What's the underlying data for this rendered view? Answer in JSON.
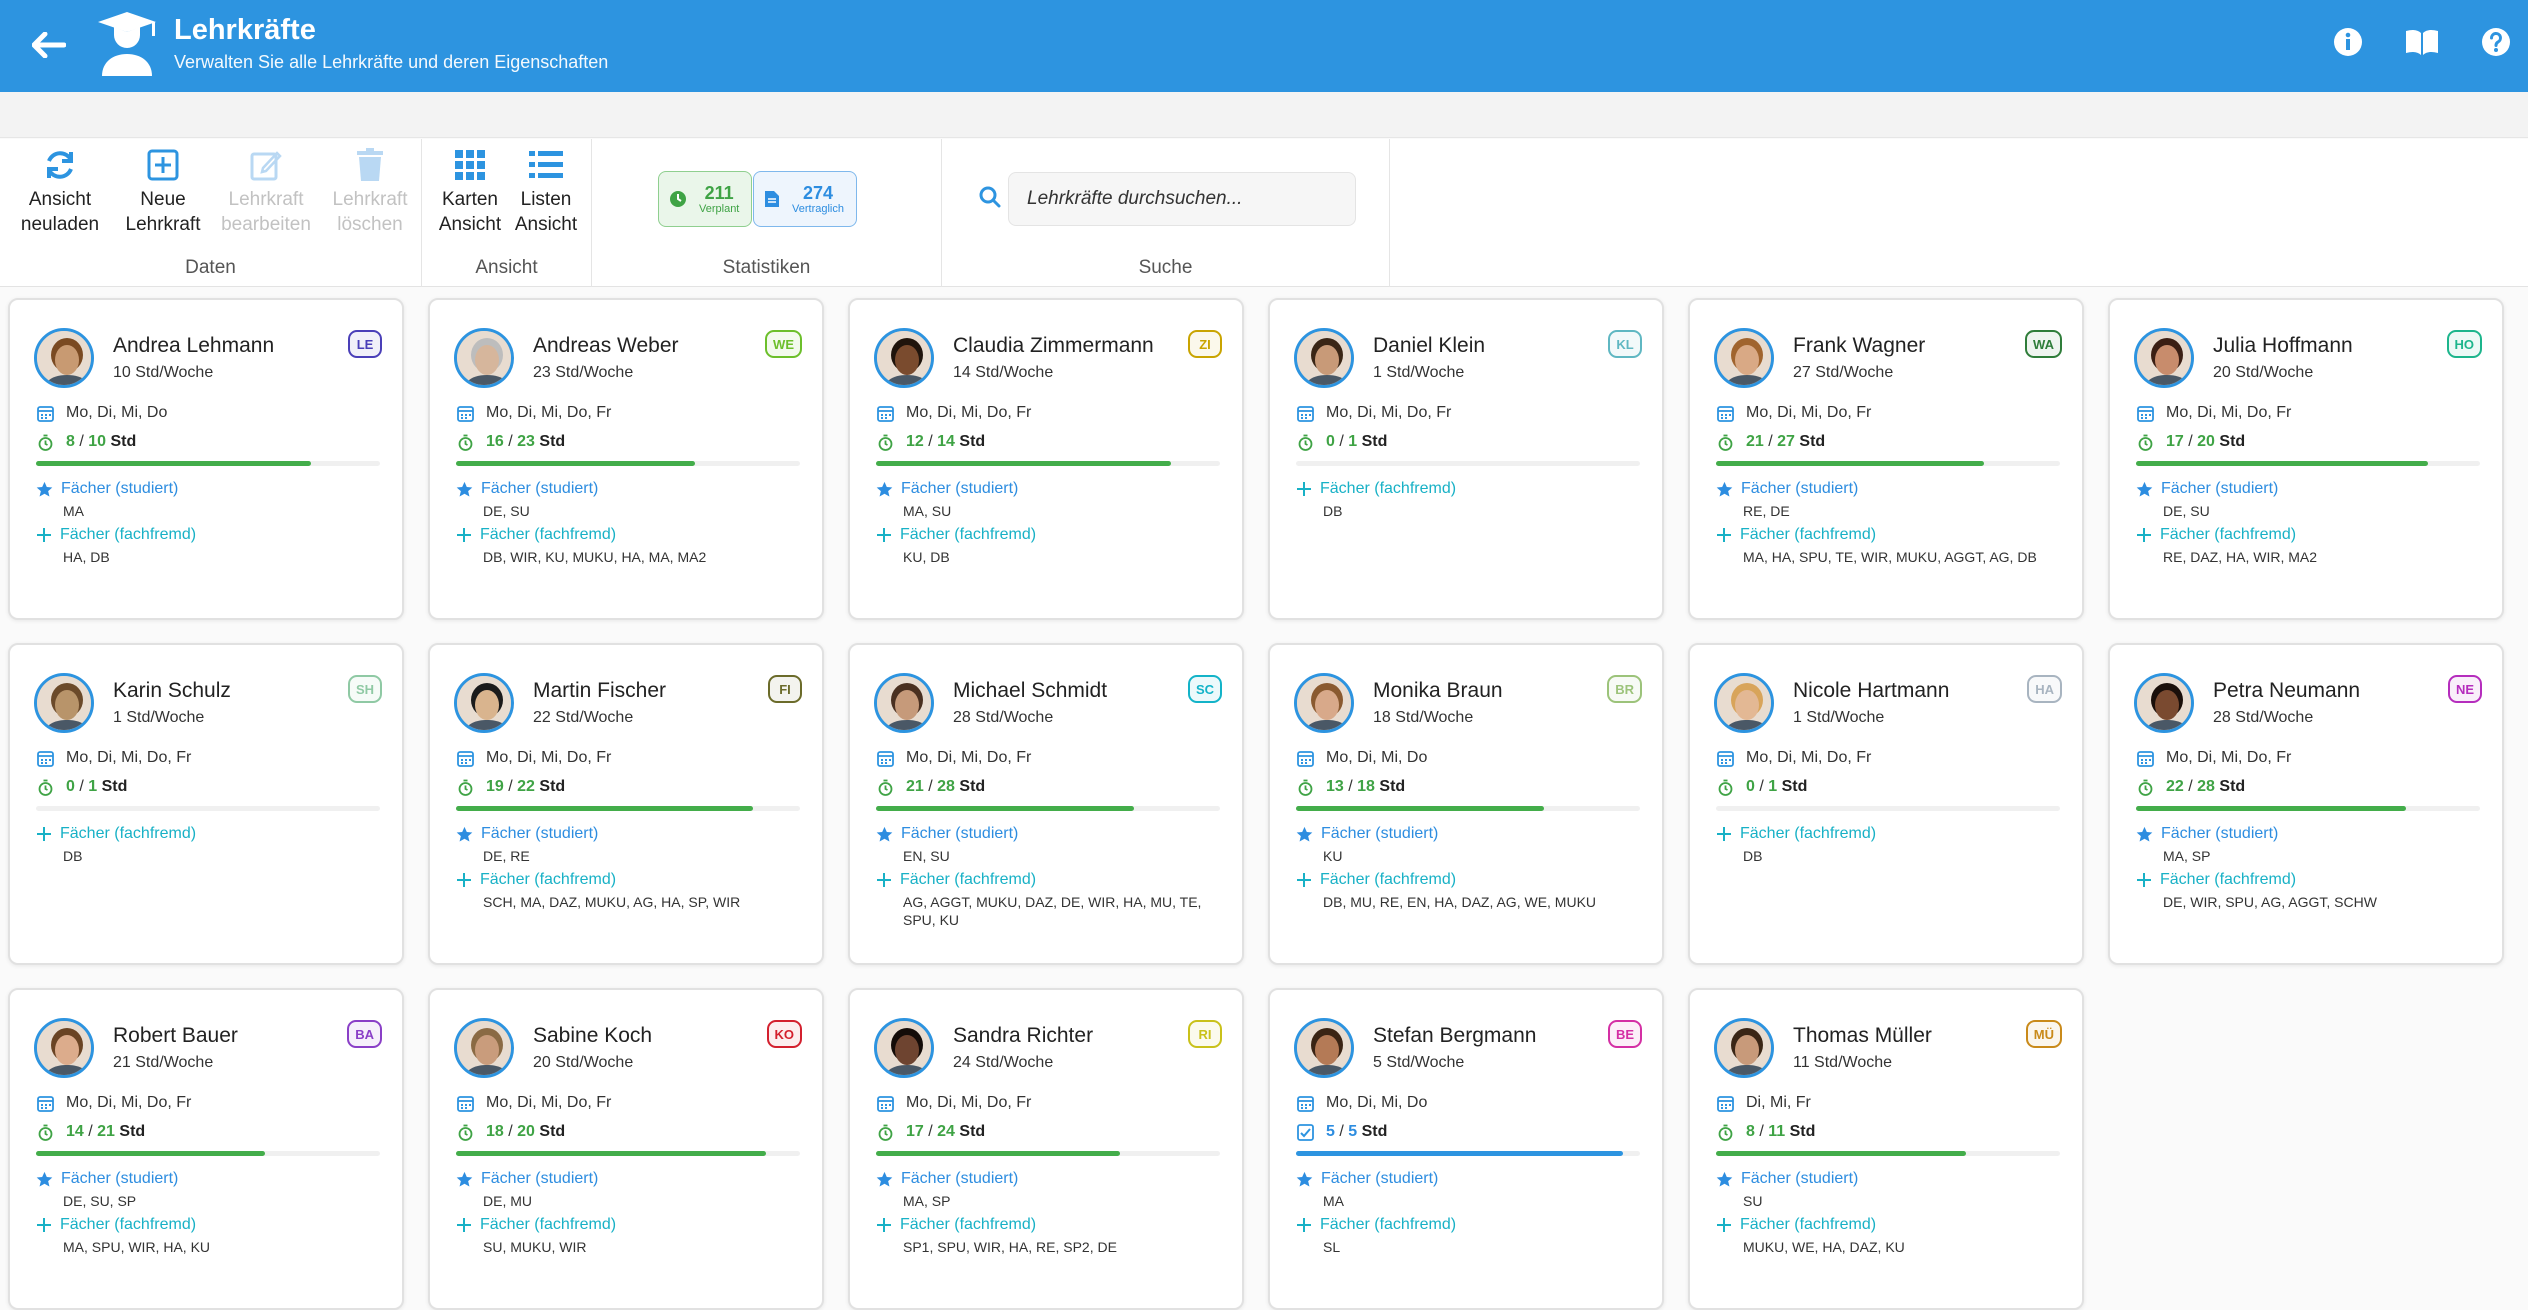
{
  "header": {
    "title": "Lehrkräfte",
    "subtitle": "Verwalten Sie alle Lehrkräfte und deren Eigenschaften"
  },
  "ribbon": {
    "daten": {
      "title": "Daten",
      "reload": "Ansicht neuladen",
      "new": "Neue Lehrkraft",
      "edit": "Lehrkraft bearbeiten",
      "delete": "Lehrkraft löschen"
    },
    "ansicht": {
      "title": "Ansicht",
      "cards": "Karten Ansicht",
      "list": "Listen Ansicht"
    },
    "statistiken": {
      "title": "Statistiken",
      "planned_value": "211",
      "planned_label": "Verplant",
      "contract_value": "274",
      "contract_label": "Vertraglich"
    },
    "suche": {
      "title": "Suche",
      "placeholder": "Lehrkräfte durchsuchen..."
    }
  },
  "labels": {
    "studied": "Fächer (studiert)",
    "foreign": "Fächer (fachfremd)",
    "std": "Std"
  },
  "teachers": [
    {
      "name": "Andrea Lehmann",
      "hours": "10 Std/Woche",
      "kuerzel": "LE",
      "badge_color": "#4a3fb8",
      "days": "Mo, Di, Mi, Do",
      "planned": "8",
      "total": "10",
      "progress": 0.8,
      "studied": "MA",
      "foreign": "HA, DB",
      "bar_color": "#43ad4a",
      "avatar": "#c89a72",
      "hair": "#7a4a22"
    },
    {
      "name": "Andreas Weber",
      "hours": "23 Std/Woche",
      "kuerzel": "WE",
      "badge_color": "#6cbf2b",
      "days": "Mo, Di, Mi, Do, Fr",
      "planned": "16",
      "total": "23",
      "progress": 0.696,
      "studied": "DE, SU",
      "foreign": "DB, WIR, KU, MUKU, HA, MA, MA2",
      "bar_color": "#43ad4a",
      "avatar": "#d6b69c",
      "hair": "#bdbdbd"
    },
    {
      "name": "Claudia Zimmermann",
      "hours": "14 Std/Woche",
      "kuerzel": "ZI",
      "badge_color": "#c9a400",
      "days": "Mo, Di, Mi, Do, Fr",
      "planned": "12",
      "total": "14",
      "progress": 0.857,
      "studied": "MA, SU",
      "foreign": "KU, DB",
      "bar_color": "#43ad4a",
      "avatar": "#7a4b2e",
      "hair": "#1f140c"
    },
    {
      "name": "Daniel Klein",
      "hours": "1 Std/Woche",
      "kuerzel": "KL",
      "badge_color": "#5fb7c2",
      "days": "Mo, Di, Mi, Do, Fr",
      "planned": "0",
      "total": "1",
      "progress": 0,
      "studied": "",
      "foreign": "DB",
      "bar_color": "#43ad4a",
      "avatar": "#c89a78",
      "hair": "#3a2616"
    },
    {
      "name": "Frank Wagner",
      "hours": "27 Std/Woche",
      "kuerzel": "WA",
      "badge_color": "#2f7d3a",
      "days": "Mo, Di, Mi, Do, Fr",
      "planned": "21",
      "total": "27",
      "progress": 0.778,
      "studied": "RE, DE",
      "foreign": "MA, HA, SPU, TE, WIR, MUKU, AGGT, AG, DB",
      "bar_color": "#43ad4a",
      "avatar": "#d9a985",
      "hair": "#a0642e"
    },
    {
      "name": "Julia Hoffmann",
      "hours": "20 Std/Woche",
      "kuerzel": "HO",
      "badge_color": "#1db58c",
      "days": "Mo, Di, Mi, Do, Fr",
      "planned": "17",
      "total": "20",
      "progress": 0.85,
      "studied": "DE, SU",
      "foreign": "RE, DAZ, HA, WIR, MA2",
      "bar_color": "#43ad4a",
      "avatar": "#c88c6c",
      "hair": "#3b1f14"
    },
    {
      "name": "Karin Schulz",
      "hours": "1 Std/Woche",
      "kuerzel": "SH",
      "badge_color": "#8fc9a4",
      "days": "Mo, Di, Mi, Do, Fr",
      "planned": "0",
      "total": "1",
      "progress": 0,
      "studied": "",
      "foreign": "DB",
      "bar_color": "#43ad4a",
      "avatar": "#b8946a",
      "hair": "#6b4a2a"
    },
    {
      "name": "Martin Fischer",
      "hours": "22 Std/Woche",
      "kuerzel": "FI",
      "badge_color": "#6b6b2a",
      "days": "Mo, Di, Mi, Do, Fr",
      "planned": "19",
      "total": "22",
      "progress": 0.864,
      "studied": "DE, RE",
      "foreign": "SCH, MA, DAZ, MUKU, AG, HA, SP, WIR",
      "bar_color": "#43ad4a",
      "avatar": "#d9b48e",
      "hair": "#1b1b1b"
    },
    {
      "name": "Michael Schmidt",
      "hours": "28 Std/Woche",
      "kuerzel": "SC",
      "badge_color": "#13b3c8",
      "days": "Mo, Di, Mi, Do, Fr",
      "planned": "21",
      "total": "28",
      "progress": 0.75,
      "studied": "EN, SU",
      "foreign": "AG, AGGT, MUKU, DAZ, DE, WIR, HA, MU, TE, SPU, KU",
      "bar_color": "#43ad4a",
      "avatar": "#c69a7a",
      "hair": "#4a3020"
    },
    {
      "name": "Monika Braun",
      "hours": "18 Std/Woche",
      "kuerzel": "BR",
      "badge_color": "#9cc37a",
      "days": "Mo, Di, Mi, Do",
      "planned": "13",
      "total": "18",
      "progress": 0.722,
      "studied": "KU",
      "foreign": "DB, MU, RE, EN, HA, DAZ, AG, WE, MUKU",
      "bar_color": "#43ad4a",
      "avatar": "#d8a98a",
      "hair": "#8a5a30"
    },
    {
      "name": "Nicole Hartmann",
      "hours": "1 Std/Woche",
      "kuerzel": "HA",
      "badge_color": "#a8b4c0",
      "days": "Mo, Di, Mi, Do, Fr",
      "planned": "0",
      "total": "1",
      "progress": 0,
      "studied": "",
      "foreign": "DB",
      "bar_color": "#43ad4a",
      "avatar": "#e3b894",
      "hair": "#d8a45a"
    },
    {
      "name": "Petra Neumann",
      "hours": "28 Std/Woche",
      "kuerzel": "NE",
      "badge_color": "#b52dbd",
      "days": "Mo, Di, Mi, Do, Fr",
      "planned": "22",
      "total": "28",
      "progress": 0.786,
      "studied": "MA, SP",
      "foreign": "DE, WIR, SPU, AG, AGGT, SCHW",
      "bar_color": "#43ad4a",
      "avatar": "#7a4a30",
      "hair": "#1a0f0a"
    },
    {
      "name": "Robert Bauer",
      "hours": "21 Std/Woche",
      "kuerzel": "BA",
      "badge_color": "#8a3fc7",
      "days": "Mo, Di, Mi, Do, Fr",
      "planned": "14",
      "total": "21",
      "progress": 0.667,
      "studied": "DE, SU, SP",
      "foreign": "MA, SPU, WIR, HA, KU",
      "bar_color": "#43ad4a",
      "avatar": "#dcac8c",
      "hair": "#6a4424"
    },
    {
      "name": "Sabine Koch",
      "hours": "20 Std/Woche",
      "kuerzel": "KO",
      "badge_color": "#d3202e",
      "days": "Mo, Di, Mi, Do, Fr",
      "planned": "18",
      "total": "20",
      "progress": 0.9,
      "studied": "DE, MU",
      "foreign": "SU, MUKU, WIR",
      "bar_color": "#43ad4a",
      "avatar": "#c99c7c",
      "hair": "#8a6a44"
    },
    {
      "name": "Sandra Richter",
      "hours": "24 Std/Woche",
      "kuerzel": "RI",
      "badge_color": "#c9c11a",
      "days": "Mo, Di, Mi, Do, Fr",
      "planned": "17",
      "total": "24",
      "progress": 0.708,
      "studied": "MA, SP",
      "foreign": "SP1, SPU, WIR, HA, RE, SP2, DE",
      "bar_color": "#43ad4a",
      "avatar": "#6e4430",
      "hair": "#140c08"
    },
    {
      "name": "Stefan Bergmann",
      "hours": "5 Std/Woche",
      "kuerzel": "BE",
      "badge_color": "#d42fa4",
      "days": "Mo, Di, Mi, Do",
      "planned": "5",
      "total": "5",
      "progress": 0.95,
      "studied": "MA",
      "foreign": "SL",
      "bar_color": "#2d94e0",
      "avatar": "#b47a56",
      "hair": "#3a2414"
    },
    {
      "name": "Thomas Müller",
      "hours": "11 Std/Woche",
      "kuerzel": "MÜ",
      "badge_color": "#c98a1a",
      "days": "Di, Mi, Fr",
      "planned": "8",
      "total": "11",
      "progress": 0.727,
      "studied": "SU",
      "foreign": "MUKU, WE, HA, DAZ, KU",
      "bar_color": "#43ad4a",
      "avatar": "#c89a7a",
      "hair": "#3a2616"
    }
  ]
}
